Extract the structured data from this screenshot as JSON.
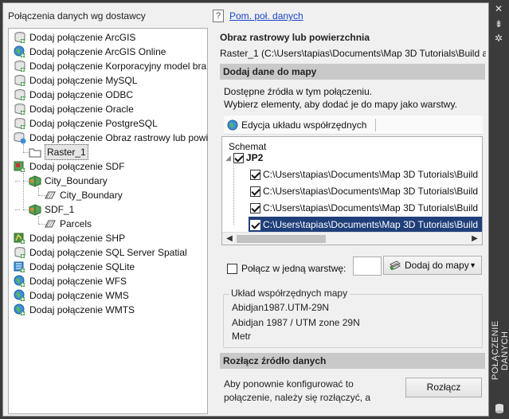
{
  "left_panel": {
    "title": "Połączenia danych wg dostawcy",
    "tree": [
      {
        "label": "Dodaj połączenie ArcGIS",
        "icon": "database-icon"
      },
      {
        "label": "Dodaj połączenie ArcGIS Online",
        "icon": "globe-icon"
      },
      {
        "label": "Dodaj połączenie Korporacyjny model bra",
        "icon": "database-icon"
      },
      {
        "label": "Dodaj połączenie MySQL",
        "icon": "database-icon"
      },
      {
        "label": "Dodaj połączenie ODBC",
        "icon": "database-icon"
      },
      {
        "label": "Dodaj połączenie Oracle",
        "icon": "database-icon"
      },
      {
        "label": "Dodaj połączenie PostgreSQL",
        "icon": "database-icon"
      },
      {
        "label": "Dodaj połączenie Obraz rastrowy lub powi",
        "icon": "raster-icon"
      },
      {
        "label": "Raster_1",
        "icon": "folder-icon"
      },
      {
        "label": "Dodaj połączenie SDF",
        "icon": "sdf-icon"
      },
      {
        "label": "City_Boundary",
        "icon": "feature-class-icon"
      },
      {
        "label": "City_Boundary",
        "icon": "polygon-layer-icon"
      },
      {
        "label": "SDF_1",
        "icon": "feature-class-icon"
      },
      {
        "label": "Parcels",
        "icon": "polygon-layer-icon"
      },
      {
        "label": "Dodaj połączenie SHP",
        "icon": "shp-icon"
      },
      {
        "label": "Dodaj połączenie SQL Server Spatial",
        "icon": "database-icon"
      },
      {
        "label": "Dodaj połączenie SQLite",
        "icon": "sqlite-icon"
      },
      {
        "label": "Dodaj połączenie WFS",
        "icon": "globe-icon"
      },
      {
        "label": "Dodaj połączenie WMS",
        "icon": "globe-icon"
      },
      {
        "label": "Dodaj połączenie WMTS",
        "icon": "globe-icon"
      }
    ]
  },
  "help": {
    "link": "Pom. poł. danych"
  },
  "connection": {
    "heading": "Obraz rastrowy lub powierzchnia",
    "path": "Raster_1 (C:\\Users\\tapias\\Documents\\Map 3D Tutorials\\Build a Ma"
  },
  "add_to_map": {
    "section_title": "Dodaj dane do mapy",
    "desc_line1": "Dostępne źródła w tym połączeniu.",
    "desc_line2": "Wybierz elementy, aby dodać je do mapy jako warstwy.",
    "toolbar_button": "Edycja układu współrzędnych",
    "schema_label": "Schemat",
    "schema_node": "JP2",
    "items": [
      "C:\\Users\\tapias\\Documents\\Map 3D Tutorials\\Build",
      "C:\\Users\\tapias\\Documents\\Map 3D Tutorials\\Build",
      "C:\\Users\\tapias\\Documents\\Map 3D Tutorials\\Build",
      "C:\\Users\\tapias\\Documents\\Map 3D Tutorials\\Build"
    ],
    "combine_label": "Połącz w jedną warstwę:",
    "layer_name_value": "",
    "add_button": "Dodaj do mapy"
  },
  "coord_system": {
    "group_title": "Układ współrzędnych mapy",
    "code": "Abidjan1987.UTM-29N",
    "name": "Abidjan 1987 / UTM zone 29N",
    "unit": "Metr"
  },
  "disconnect": {
    "section_title": "Rozłącz źródło danych",
    "text_line1": "Aby ponownie konfigurować to",
    "text_line2": "połączenie, należy się rozłączyć, a",
    "button": "Rozłącz"
  },
  "side_panel": {
    "title": "POŁĄCZENIE DANYCH"
  },
  "colors": {
    "selection": "#1f3f7a",
    "section_bar": "#c9c9c9",
    "link": "#1a45c8",
    "dark_frame": "#3b3b3b"
  }
}
